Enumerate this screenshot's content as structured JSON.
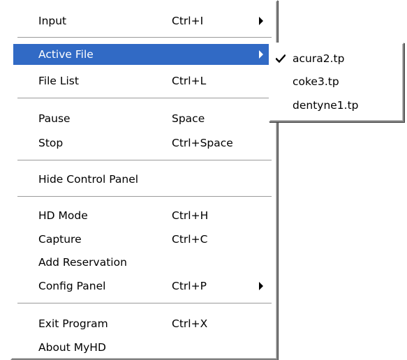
{
  "main_menu": {
    "items": [
      {
        "label": "Input",
        "shortcut": "Ctrl+I",
        "submenu": true
      },
      {
        "label": "Active File",
        "shortcut": "",
        "submenu": true,
        "highlighted": true
      },
      {
        "label": "File List",
        "shortcut": "Ctrl+L"
      },
      {
        "label": "Pause",
        "shortcut": "Space"
      },
      {
        "label": "Stop",
        "shortcut": "Ctrl+Space"
      },
      {
        "label": "Hide Control Panel",
        "shortcut": ""
      },
      {
        "label": "HD Mode",
        "shortcut": "Ctrl+H"
      },
      {
        "label": "Capture",
        "shortcut": "Ctrl+C"
      },
      {
        "label": "Add Reservation",
        "shortcut": ""
      },
      {
        "label": "Config Panel",
        "shortcut": "Ctrl+P",
        "submenu": true
      },
      {
        "label": "Exit Program",
        "shortcut": "Ctrl+X"
      },
      {
        "label": "About MyHD",
        "shortcut": ""
      }
    ]
  },
  "active_file_submenu": {
    "items": [
      {
        "label": "acura2.tp",
        "checked": true
      },
      {
        "label": "coke3.tp",
        "checked": false
      },
      {
        "label": "dentyne1.tp",
        "checked": false
      }
    ]
  },
  "colors": {
    "highlight": "#316ac5",
    "highlight_text": "#ffffff",
    "menu_background": "#ffffff"
  }
}
